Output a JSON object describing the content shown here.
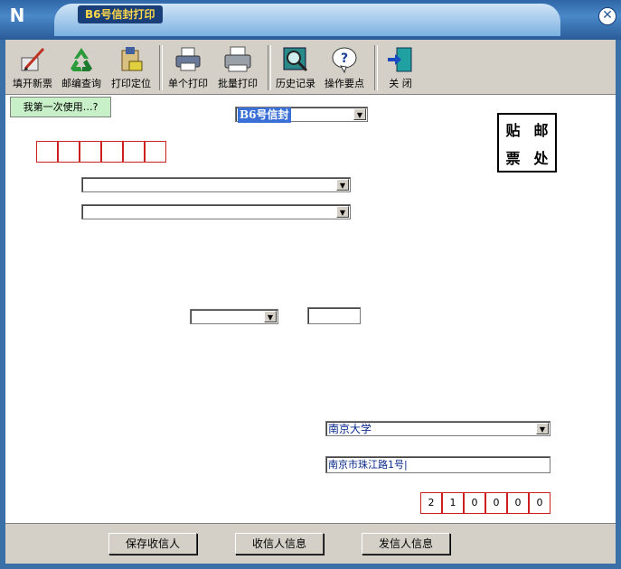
{
  "window": {
    "title": "B6号信封打印",
    "logo": "N"
  },
  "toolbar": {
    "buttons": [
      {
        "label": "填开新票",
        "icon": "pen-ticket-icon"
      },
      {
        "label": "邮编查询",
        "icon": "recycle-icon"
      },
      {
        "label": "打印定位",
        "icon": "locate-icon"
      },
      {
        "label": "单个打印",
        "icon": "printer-icon"
      },
      {
        "label": "批量打印",
        "icon": "batch-printer-icon"
      },
      {
        "label": "历史记录",
        "icon": "history-search-icon"
      },
      {
        "label": "操作要点",
        "icon": "help-icon"
      },
      {
        "label": "关  闭",
        "icon": "exit-door-icon"
      }
    ]
  },
  "first_use_label": "我第一次使用…?",
  "envelope_type": "B6号信封",
  "stamp": {
    "c1": "贴",
    "c2": "邮",
    "c3": "票",
    "c4": "处"
  },
  "recipient": {
    "zip": [
      "",
      "",
      "",
      "",
      "",
      ""
    ],
    "address1": "",
    "address2": "",
    "title_select": "",
    "name": ""
  },
  "sender": {
    "org": "南京大学",
    "address": "南京市珠江路1号|",
    "zip": [
      "2",
      "1",
      "0",
      "0",
      "0",
      "0"
    ]
  },
  "bottom_buttons": {
    "save": "保存收信人",
    "recipient_info": "收信人信息",
    "sender_info": "发信人信息"
  },
  "close_symbol": "✕",
  "dropdown_arrow": "▼"
}
